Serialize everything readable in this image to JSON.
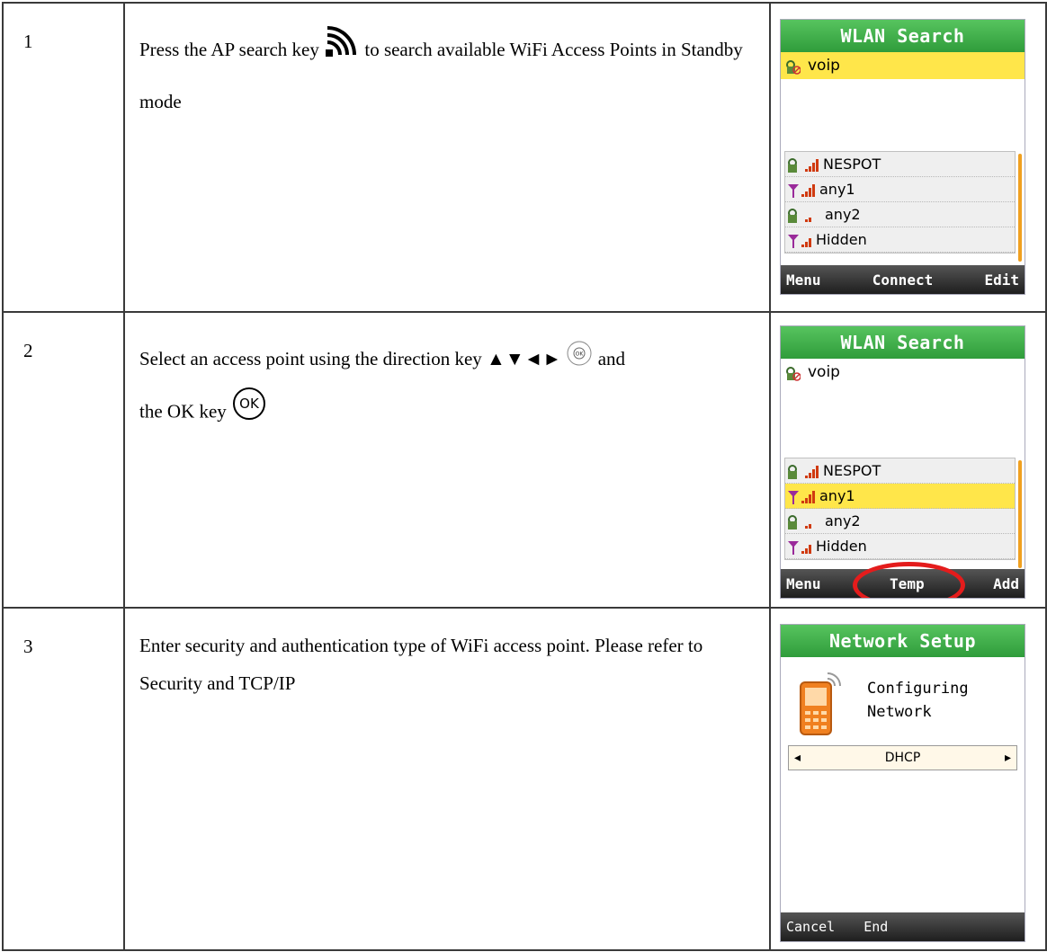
{
  "steps": [
    {
      "num": "1",
      "text_before": "Press the AP search key",
      "text_after": "to search available WiFi Access Points in Standby mode",
      "screen": {
        "title": "WLAN Search",
        "top_item": "voip",
        "list": [
          "NESPOT",
          "any1",
          "any2",
          "Hidden"
        ],
        "softkeys": [
          "Menu",
          "Connect",
          "Edit"
        ]
      }
    },
    {
      "num": "2",
      "text_before": "Select an access point using the direction key ▲▼◄►",
      "text_middle": "and",
      "text_line2": "the OK key",
      "screen": {
        "title": "WLAN Search",
        "top_item": "voip",
        "list": [
          "NESPOT",
          "any1",
          "any2",
          "Hidden"
        ],
        "softkeys": [
          "Menu",
          "Temp",
          "Add"
        ]
      }
    },
    {
      "num": "3",
      "text": "Enter security and authentication type of WiFi access point. Please refer to Security and TCP/IP",
      "screen": {
        "title": "Network Setup",
        "line1": "Configuring",
        "line2": "Network",
        "selector": "DHCP",
        "softkeys": [
          "Cancel",
          "End"
        ]
      }
    }
  ],
  "ok_key_label": "OK",
  "colors": {
    "title_green": "#2f9c3b",
    "highlight": "#ffe64a",
    "ring": "#e41c1c"
  }
}
